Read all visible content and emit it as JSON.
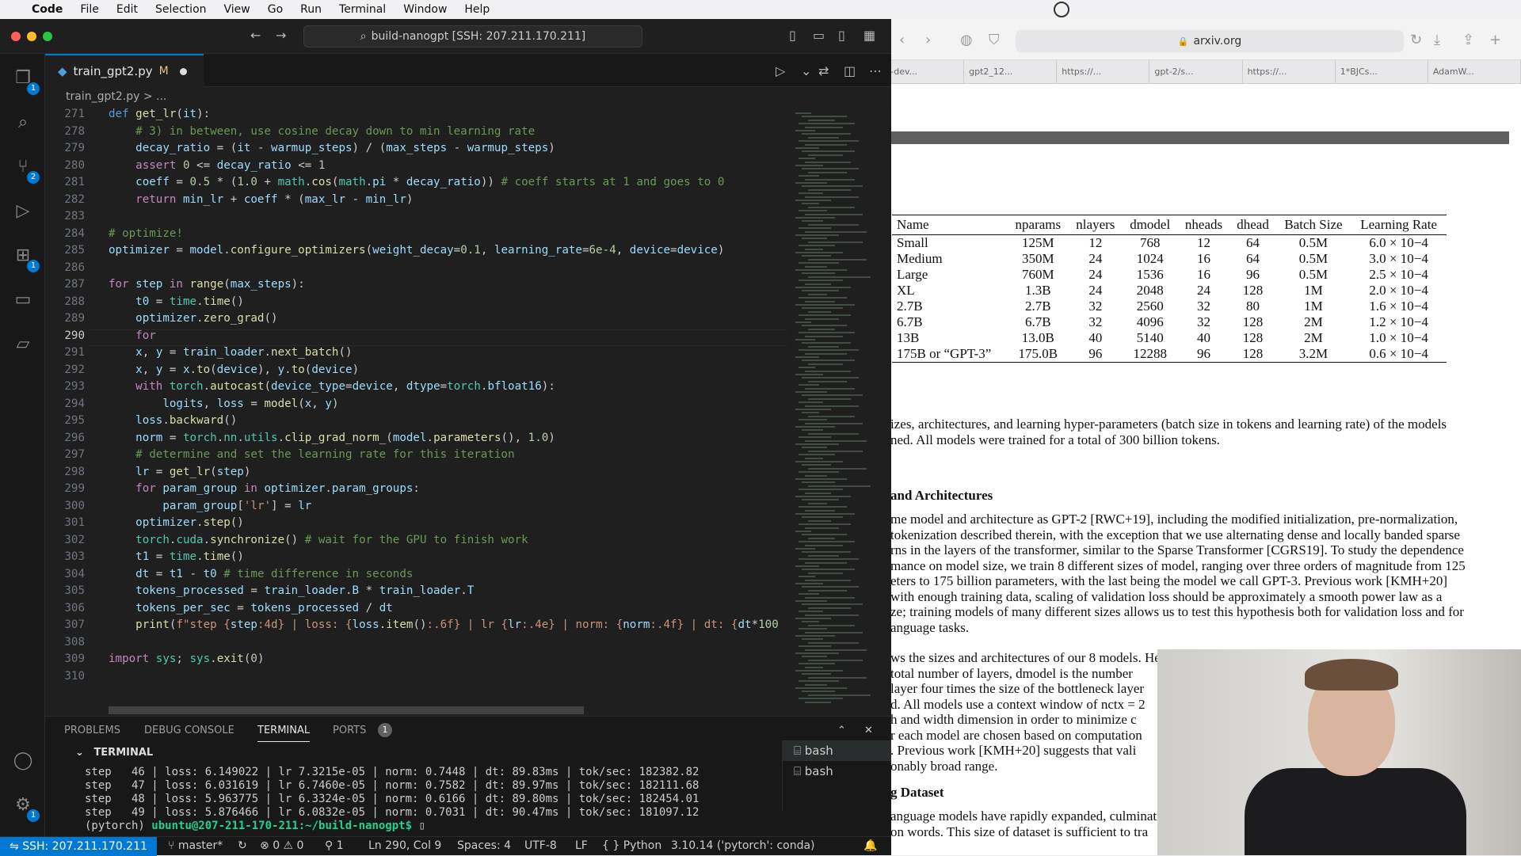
{
  "menubar": {
    "app": "Code",
    "items": [
      "File",
      "Edit",
      "Selection",
      "View",
      "Go",
      "Run",
      "Terminal",
      "Window",
      "Help"
    ]
  },
  "vscode": {
    "command_center": "build-nanogpt [SSH: 207.211.170.211]",
    "tab": {
      "name": "train_gpt2.py",
      "status": "M"
    },
    "breadcrumb": "train_gpt2.py > ...",
    "activity_badges": {
      "explorer": "1",
      "scm": "2",
      "extensions": "1",
      "settings": "1"
    },
    "code_lines": [
      {
        "n": "271",
        "html": "<span class=\"kb\">def</span> <span class=\"fn\">get_lr</span>(<span class=\"vr\">it</span>):"
      },
      {
        "n": "278",
        "html": "    <span class=\"cm\"># 3) in between, use cosine decay down to min learning rate</span>"
      },
      {
        "n": "279",
        "html": "    <span class=\"vr\">decay_ratio</span> = (<span class=\"vr\">it</span> - <span class=\"vr\">warmup_steps</span>) / (<span class=\"vr\">max_steps</span> - <span class=\"vr\">warmup_steps</span>)"
      },
      {
        "n": "280",
        "html": "    <span class=\"kw\">assert</span> <span class=\"nm\">0</span> &lt;= <span class=\"vr\">decay_ratio</span> &lt;= <span class=\"nm\">1</span>"
      },
      {
        "n": "281",
        "html": "    <span class=\"vr\">coeff</span> = <span class=\"nm\">0.5</span> * (<span class=\"nm\">1.0</span> + <span class=\"cl\">math</span>.<span class=\"fn\">cos</span>(<span class=\"cl\">math</span>.<span class=\"vr\">pi</span> * <span class=\"vr\">decay_ratio</span>)) <span class=\"cm\"># coeff starts at 1 and goes to 0</span>"
      },
      {
        "n": "282",
        "html": "    <span class=\"kw\">return</span> <span class=\"vr\">min_lr</span> + <span class=\"vr\">coeff</span> * (<span class=\"vr\">max_lr</span> - <span class=\"vr\">min_lr</span>)"
      },
      {
        "n": "283",
        "html": ""
      },
      {
        "n": "284",
        "html": "<span class=\"cm\"># optimize!</span>"
      },
      {
        "n": "285",
        "html": "<span class=\"vr\">optimizer</span> = <span class=\"vr\">model</span>.<span class=\"fn\">configure_optimizers</span>(<span class=\"vr\">weight_decay</span>=<span class=\"nm\">0.1</span>, <span class=\"vr\">learning_rate</span>=<span class=\"nm\">6e-4</span>, <span class=\"vr\">device</span>=<span class=\"vr\">device</span>)"
      },
      {
        "n": "286",
        "html": ""
      },
      {
        "n": "287",
        "html": "<span class=\"kw\">for</span> <span class=\"vr\">step</span> <span class=\"kw\">in</span> <span class=\"fn\">range</span>(<span class=\"vr\">max_steps</span>):"
      },
      {
        "n": "288",
        "html": "    <span class=\"vr\">t0</span> = <span class=\"cl\">time</span>.<span class=\"fn\">time</span>()"
      },
      {
        "n": "289",
        "html": "    <span class=\"vr\">optimizer</span>.<span class=\"fn\">zero_grad</span>()"
      },
      {
        "n": "290",
        "html": "    <span class=\"kw\">for</span>"
      },
      {
        "n": "291",
        "html": "    <span class=\"vr\">x</span>, <span class=\"vr\">y</span> = <span class=\"vr\">train_loader</span>.<span class=\"fn\">next_batch</span>()"
      },
      {
        "n": "292",
        "html": "    <span class=\"vr\">x</span>, <span class=\"vr\">y</span> = <span class=\"vr\">x</span>.<span class=\"fn\">to</span>(<span class=\"vr\">device</span>), <span class=\"vr\">y</span>.<span class=\"fn\">to</span>(<span class=\"vr\">device</span>)"
      },
      {
        "n": "293",
        "html": "    <span class=\"kw\">with</span> <span class=\"cl\">torch</span>.<span class=\"fn\">autocast</span>(<span class=\"vr\">device_type</span>=<span class=\"vr\">device</span>, <span class=\"vr\">dtype</span>=<span class=\"cl\">torch</span>.<span class=\"vr\">bfloat16</span>):"
      },
      {
        "n": "294",
        "html": "        <span class=\"vr\">logits</span>, <span class=\"vr\">loss</span> = <span class=\"fn\">model</span>(<span class=\"vr\">x</span>, <span class=\"vr\">y</span>)"
      },
      {
        "n": "295",
        "html": "    <span class=\"vr\">loss</span>.<span class=\"fn\">backward</span>()"
      },
      {
        "n": "296",
        "html": "    <span class=\"vr\">norm</span> = <span class=\"cl\">torch</span>.<span class=\"cl\">nn</span>.<span class=\"cl\">utils</span>.<span class=\"fn\">clip_grad_norm_</span>(<span class=\"vr\">model</span>.<span class=\"fn\">parameters</span>(), <span class=\"nm\">1.0</span>)"
      },
      {
        "n": "297",
        "html": "    <span class=\"cm\"># determine and set the learning rate for this iteration</span>"
      },
      {
        "n": "298",
        "html": "    <span class=\"vr\">lr</span> = <span class=\"fn\">get_lr</span>(<span class=\"vr\">step</span>)"
      },
      {
        "n": "299",
        "html": "    <span class=\"kw\">for</span> <span class=\"vr\">param_group</span> <span class=\"kw\">in</span> <span class=\"vr\">optimizer</span>.<span class=\"vr\">param_groups</span>:"
      },
      {
        "n": "300",
        "html": "        <span class=\"vr\">param_group</span>[<span class=\"str\">'lr'</span>] = <span class=\"vr\">lr</span>"
      },
      {
        "n": "301",
        "html": "    <span class=\"vr\">optimizer</span>.<span class=\"fn\">step</span>()"
      },
      {
        "n": "302",
        "html": "    <span class=\"cl\">torch</span>.<span class=\"cl\">cuda</span>.<span class=\"fn\">synchronize</span>() <span class=\"cm\"># wait for the GPU to finish work</span>"
      },
      {
        "n": "303",
        "html": "    <span class=\"vr\">t1</span> = <span class=\"cl\">time</span>.<span class=\"fn\">time</span>()"
      },
      {
        "n": "304",
        "html": "    <span class=\"vr\">dt</span> = <span class=\"vr\">t1</span> - <span class=\"vr\">t0</span> <span class=\"cm\"># time difference in seconds</span>"
      },
      {
        "n": "305",
        "html": "    <span class=\"vr\">tokens_processed</span> = <span class=\"vr\">train_loader</span>.<span class=\"vr\">B</span> * <span class=\"vr\">train_loader</span>.<span class=\"vr\">T</span>"
      },
      {
        "n": "306",
        "html": "    <span class=\"vr\">tokens_per_sec</span> = <span class=\"vr\">tokens_processed</span> / <span class=\"vr\">dt</span>"
      },
      {
        "n": "307",
        "html": "    <span class=\"fn\">print</span>(<span class=\"str\">f\"step {</span><span class=\"vr\">step</span><span class=\"str\">:4d} | loss: {</span><span class=\"vr\">loss</span>.<span class=\"fn\">item</span>()<span class=\"str\">:.6f} | lr {</span><span class=\"vr\">lr</span><span class=\"str\">:.4e} | norm: {</span><span class=\"vr\">norm</span><span class=\"str\">:.4f} | dt: {</span><span class=\"vr\">dt</span>*<span class=\"nm\">100</span>"
      },
      {
        "n": "308",
        "html": ""
      },
      {
        "n": "309",
        "html": "<span class=\"kw\">import</span> <span class=\"cl\">sys</span>; <span class=\"cl\">sys</span>.<span class=\"fn\">exit</span>(<span class=\"nm\">0</span>)"
      },
      {
        "n": "310",
        "html": ""
      }
    ],
    "panel_tabs": [
      "PROBLEMS",
      "DEBUG CONSOLE",
      "TERMINAL",
      "PORTS"
    ],
    "ports_count": "1",
    "terminal_header": "TERMINAL",
    "terminal_lines": [
      "step   46 | loss: 6.149022 | lr 7.3215e-05 | norm: 0.7448 | dt: 89.83ms | tok/sec: 182382.82",
      "step   47 | loss: 6.031619 | lr 6.7460e-05 | norm: 0.7582 | dt: 89.97ms | tok/sec: 182111.68",
      "step   48 | loss: 5.963775 | lr 6.3324e-05 | norm: 0.6166 | dt: 89.80ms | tok/sec: 182454.01",
      "step   49 | loss: 5.876466 | lr 6.0832e-05 | norm: 0.7031 | dt: 90.47ms | tok/sec: 181097.12"
    ],
    "prompt_env": "(pytorch)",
    "prompt_path": "ubuntu@207-211-170-211:~/build-nanogpt$",
    "terminal_list": [
      "bash",
      "bash"
    ],
    "status": {
      "ssh": "SSH: 207.211.170.211",
      "branch": "master*",
      "problems": "0 ⚠ 0",
      "ports": "1",
      "cursor": "Ln 290, Col 9",
      "spaces": "Spaces: 4",
      "encoding": "UTF-8",
      "eol": "LF",
      "language": "Python",
      "interpreter": "3.10.14 ('pytorch': conda)"
    }
  },
  "browser": {
    "url": "arxiv.org",
    "tabs": [
      "gpt-dev...",
      "gpt2_12...",
      "https://...",
      "gpt-2/s...",
      "https://...",
      "1*BJCs...",
      "AdamW..."
    ],
    "table": {
      "headers": [
        "Name",
        "nparams",
        "nlayers",
        "dmodel",
        "nheads",
        "dhead",
        "Batch Size",
        "Learning Rate"
      ],
      "rows": [
        [
          "Small",
          "125M",
          "12",
          "768",
          "12",
          "64",
          "0.5M",
          "6.0 × 10−4"
        ],
        [
          "Medium",
          "350M",
          "24",
          "1024",
          "16",
          "64",
          "0.5M",
          "3.0 × 10−4"
        ],
        [
          "Large",
          "760M",
          "24",
          "1536",
          "16",
          "96",
          "0.5M",
          "2.5 × 10−4"
        ],
        [
          "XL",
          "1.3B",
          "24",
          "2048",
          "24",
          "128",
          "1M",
          "2.0 × 10−4"
        ],
        [
          "2.7B",
          "2.7B",
          "32",
          "2560",
          "32",
          "80",
          "1M",
          "1.6 × 10−4"
        ],
        [
          "6.7B",
          "6.7B",
          "32",
          "4096",
          "32",
          "128",
          "2M",
          "1.2 × 10−4"
        ],
        [
          "13B",
          "13.0B",
          "40",
          "5140",
          "40",
          "128",
          "2M",
          "1.0 × 10−4"
        ],
        [
          "175B or “GPT-3”",
          "175.0B",
          "96",
          "12288",
          "96",
          "128",
          "3.2M",
          "0.6 × 10−4"
        ]
      ]
    },
    "caption": [
      "izes, architectures, and learning hyper-parameters (batch size in tokens and learning rate) of the models",
      "ned. All models were trained for a total of 300 billion tokens."
    ],
    "heading1": "and Architectures",
    "para1": [
      "me model and architecture as GPT-2 [RWC+19], including the modified initialization, pre-normalization,",
      "tokenization described therein, with the exception that we use alternating dense and locally banded sparse",
      "rns in the layers of the transformer, similar to the Sparse Transformer [CGRS19]. To study the dependence",
      "mance on model size, we train 8 different sizes of model, ranging over three orders of magnitude from 125",
      "eters to 175 billion parameters, with the last being the model we call GPT-3. Previous work [KMH+20]",
      "with enough training data, scaling of validation loss should be approximately a smooth power law as a",
      "ze; training models of many different sizes allows us to test this hypothesis both for validation loss and for",
      "anguage tasks."
    ],
    "para2": [
      "ws the sizes and architectures of our 8 models. Here nparams is the total number of trainable parameters,",
      "total number of layers, dmodel is the number",
      "layer four times the size of the bottleneck layer",
      "d. All models use a context window of nctx = 2",
      "h and width dimension in order to minimize c",
      "r each model are chosen based on computation",
      ". Previous work [KMH+20] suggests that vali",
      "onably broad range."
    ],
    "heading2": "g Dataset",
    "para3": [
      "anguage models have rapidly expanded, culminati",
      "on words. This size of dataset is sufficient to tra"
    ]
  }
}
